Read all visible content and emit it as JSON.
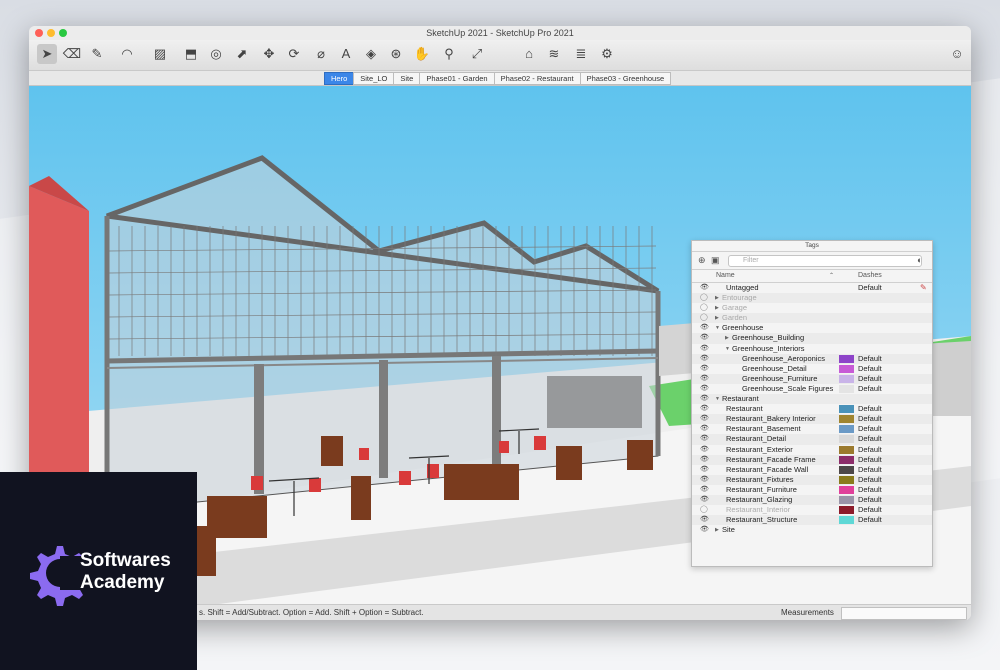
{
  "window": {
    "title": "SketchUp 2021 - SketchUp Pro 2021"
  },
  "toolbar": {
    "tools": [
      {
        "icon": "select-icon"
      },
      {
        "icon": "eraser-icon"
      },
      {
        "icon": "pencil-icon"
      },
      {
        "icon": "arc-icon"
      },
      {
        "icon": "rectangle-icon"
      },
      {
        "icon": "push-pull-icon"
      },
      {
        "icon": "offset-icon"
      },
      {
        "icon": "follow-me-icon"
      },
      {
        "icon": "move-icon"
      },
      {
        "icon": "rotate-icon"
      },
      {
        "icon": "tape-measure-icon"
      },
      {
        "icon": "text-icon"
      },
      {
        "icon": "paint-bucket-icon"
      },
      {
        "icon": "orbit-icon"
      },
      {
        "icon": "pan-icon"
      },
      {
        "icon": "zoom-icon"
      },
      {
        "icon": "zoom-extents-icon"
      },
      {
        "icon": "warehouse-icon"
      },
      {
        "icon": "extension-icon"
      },
      {
        "icon": "layers-icon"
      },
      {
        "icon": "extension-manager-icon"
      },
      {
        "icon": "account-icon"
      }
    ]
  },
  "scenes": {
    "tabs": [
      "Hero",
      "Site_LO",
      "Site",
      "Phase01 - Garden",
      "Phase02 - Restaurant",
      "Phase03 - Greenhouse"
    ],
    "active": "Hero"
  },
  "tags_panel": {
    "title": "Tags",
    "filter_placeholder": "Filter",
    "col_name": "Name",
    "col_dashes": "Dashes",
    "rows": [
      {
        "name": "Untagged",
        "dash": "Default",
        "muted": false,
        "eye": "visible",
        "swatch": null,
        "indent": 1
      },
      {
        "name": "Entourage",
        "dash": "",
        "muted": true,
        "eye": "hidden",
        "swatch": null,
        "indent": 0,
        "arrow": "▶"
      },
      {
        "name": "Garage",
        "dash": "",
        "muted": true,
        "eye": "hidden",
        "swatch": null,
        "indent": 0,
        "arrow": "▶"
      },
      {
        "name": "Garden",
        "dash": "",
        "muted": true,
        "eye": "hidden",
        "swatch": null,
        "indent": 0,
        "arrow": "▶"
      },
      {
        "name": "Greenhouse",
        "dash": "",
        "muted": false,
        "eye": "visible",
        "swatch": null,
        "indent": 0,
        "arrow": "▼"
      },
      {
        "name": "Greenhouse_Building",
        "dash": "",
        "muted": false,
        "eye": "visible",
        "swatch": null,
        "indent": 1,
        "arrow": "▶"
      },
      {
        "name": "Greenhouse_Interiors",
        "dash": "",
        "muted": false,
        "eye": "visible",
        "swatch": null,
        "indent": 1,
        "arrow": "▼"
      },
      {
        "name": "Greenhouse_Aeroponics",
        "dash": "Default",
        "muted": false,
        "eye": "visible",
        "swatch": "#8e44c9",
        "indent": 2
      },
      {
        "name": "Greenhouse_Detail",
        "dash": "Default",
        "muted": false,
        "eye": "visible",
        "swatch": "#c75bd6",
        "indent": 2
      },
      {
        "name": "Greenhouse_Furniture",
        "dash": "Default",
        "muted": false,
        "eye": "visible",
        "swatch": "#c9b4e8",
        "indent": 2
      },
      {
        "name": "Greenhouse_Scale Figures",
        "dash": "Default",
        "muted": false,
        "eye": "visible",
        "swatch": "#e4e4e4",
        "indent": 2
      },
      {
        "name": "Restaurant",
        "dash": "",
        "muted": false,
        "eye": "visible",
        "swatch": null,
        "indent": 0,
        "arrow": "▼"
      },
      {
        "name": "Restaurant",
        "dash": "Default",
        "muted": false,
        "eye": "visible",
        "swatch": "#4a92b9",
        "indent": 1
      },
      {
        "name": "Restaurant_Bakery Interior",
        "dash": "Default",
        "muted": false,
        "eye": "visible",
        "swatch": "#a08530",
        "indent": 1
      },
      {
        "name": "Restaurant_Basement",
        "dash": "Default",
        "muted": false,
        "eye": "visible",
        "swatch": "#6b9ac6",
        "indent": 1
      },
      {
        "name": "Restaurant_Detail",
        "dash": "Default",
        "muted": false,
        "eye": "visible",
        "swatch": "#d9d9d9",
        "indent": 1
      },
      {
        "name": "Restaurant_Exterior",
        "dash": "Default",
        "muted": false,
        "eye": "visible",
        "swatch": "#9b7a2e",
        "indent": 1
      },
      {
        "name": "Restaurant_Facade Frame",
        "dash": "Default",
        "muted": false,
        "eye": "visible",
        "swatch": "#8c2d6a",
        "indent": 1
      },
      {
        "name": "Restaurant_Facade Wall",
        "dash": "Default",
        "muted": false,
        "eye": "visible",
        "swatch": "#4d4848",
        "indent": 1
      },
      {
        "name": "Restaurant_Fixtures",
        "dash": "Default",
        "muted": false,
        "eye": "visible",
        "swatch": "#8a7b1c",
        "indent": 1
      },
      {
        "name": "Restaurant_Furniture",
        "dash": "Default",
        "muted": false,
        "eye": "visible",
        "swatch": "#e0409a",
        "indent": 1
      },
      {
        "name": "Restaurant_Glazing",
        "dash": "Default",
        "muted": false,
        "eye": "visible",
        "swatch": "#9a94a8",
        "indent": 1
      },
      {
        "name": "Restaurant_Interior",
        "dash": "Default",
        "muted": true,
        "eye": "hidden",
        "swatch": "#8c1b2a",
        "indent": 1
      },
      {
        "name": "Restaurant_Structure",
        "dash": "Default",
        "muted": false,
        "eye": "visible",
        "swatch": "#5fd8d6",
        "indent": 1
      },
      {
        "name": "Site",
        "dash": "",
        "muted": false,
        "eye": "visible",
        "swatch": null,
        "indent": 0,
        "arrow": "▶"
      }
    ]
  },
  "status": {
    "hint": "s. Shift = Add/Subtract. Option = Add. Shift + Option = Subtract.",
    "measurements_label": "Measurements",
    "measurements_value": ""
  },
  "brand": {
    "line1": "Softwares",
    "line2": "Academy",
    "accent": "#8b6bf0"
  }
}
